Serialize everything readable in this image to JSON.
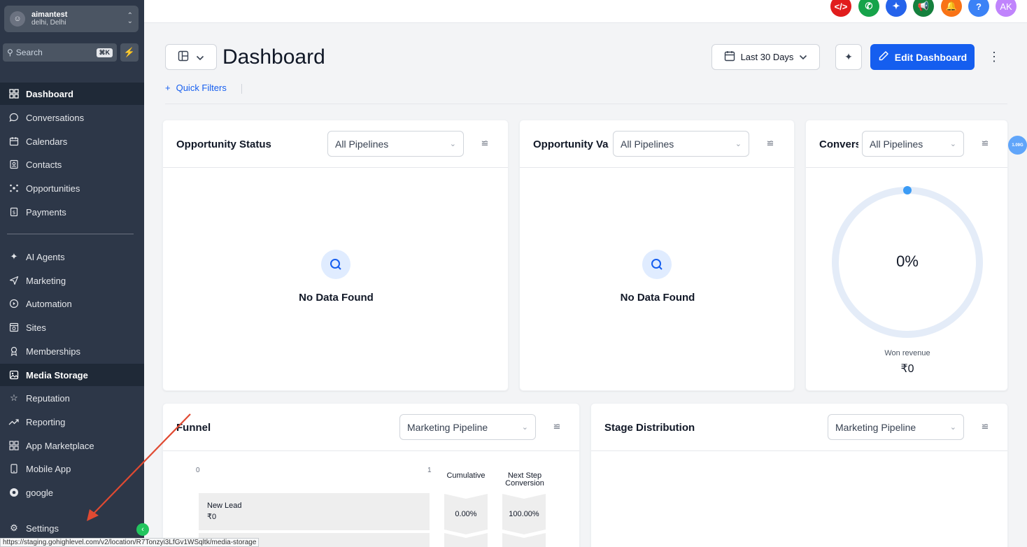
{
  "account": {
    "name": "aimantest",
    "location": "delhi, Delhi"
  },
  "search": {
    "placeholder": "Search",
    "shortcut": "⌘K"
  },
  "sidebar": {
    "items": [
      {
        "label": "Dashboard",
        "icon": "grid-icon"
      },
      {
        "label": "Conversations",
        "icon": "chat-icon"
      },
      {
        "label": "Calendars",
        "icon": "calendar-icon"
      },
      {
        "label": "Contacts",
        "icon": "contacts-icon"
      },
      {
        "label": "Opportunities",
        "icon": "opportunities-icon"
      },
      {
        "label": "Payments",
        "icon": "payments-icon"
      },
      {
        "label": "AI Agents",
        "icon": "sparkle-icon"
      },
      {
        "label": "Marketing",
        "icon": "send-icon"
      },
      {
        "label": "Automation",
        "icon": "automation-icon"
      },
      {
        "label": "Sites",
        "icon": "sites-icon"
      },
      {
        "label": "Memberships",
        "icon": "memberships-icon"
      },
      {
        "label": "Media Storage",
        "icon": "image-icon"
      },
      {
        "label": "Reputation",
        "icon": "star-icon"
      },
      {
        "label": "Reporting",
        "icon": "trend-icon"
      },
      {
        "label": "App Marketplace",
        "icon": "apps-icon"
      },
      {
        "label": "Mobile App",
        "icon": "mobile-icon"
      },
      {
        "label": "google",
        "icon": "google-icon"
      },
      {
        "label": "Settings",
        "icon": "gear-icon"
      }
    ]
  },
  "topbar": {
    "avatar_initials": "AK"
  },
  "header": {
    "title": "Dashboard",
    "date_range": "Last 30 Days",
    "edit_label": "Edit Dashboard",
    "quick_filters": "Quick Filters"
  },
  "cards": {
    "opportunity_status": {
      "title": "Opportunity Status",
      "select": "All Pipelines",
      "empty": "No Data Found"
    },
    "opportunity_value": {
      "title": "Opportunity Value",
      "select": "All Pipelines",
      "empty": "No Data Found"
    },
    "conversion": {
      "title": "Conversion Rate",
      "select": "All Pipelines",
      "percent": "0%",
      "sub_label": "Won revenue",
      "sub_value": "₹0"
    },
    "funnel": {
      "title": "Funnel",
      "select": "Marketing Pipeline",
      "axis_min": "0",
      "axis_max": "1",
      "col_cumulative": "Cumulative",
      "col_next": "Next Step Conversion",
      "rows": [
        {
          "stage": "New Lead",
          "value": "₹0",
          "cumulative": "0.00%",
          "next": "100.00%"
        }
      ]
    },
    "stage_distribution": {
      "title": "Stage Distribution",
      "select": "Marketing Pipeline"
    }
  },
  "side_badge": "1.09G",
  "status_url": "https://staging.gohighlevel.com/v2/location/R7Tonzyi3LfGv1WSqltk/media-storage",
  "colors": {
    "sidebar_bg": "#2d3748",
    "primary": "#155eef",
    "collapse_green": "#22c55e"
  }
}
